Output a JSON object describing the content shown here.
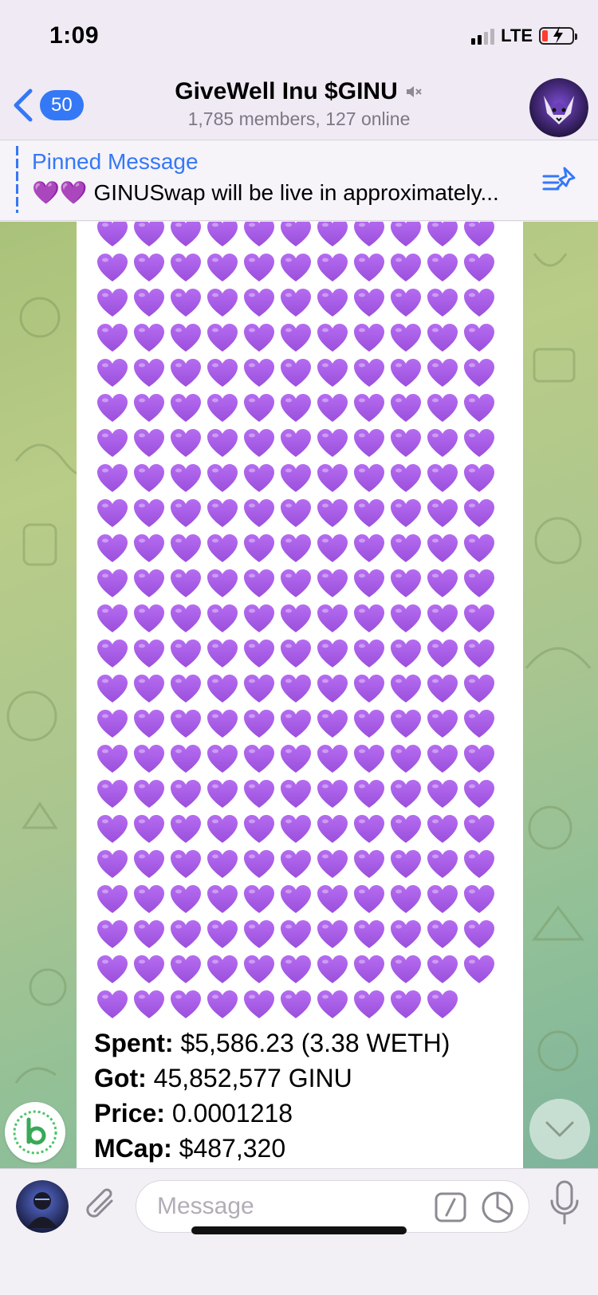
{
  "status_bar": {
    "time": "1:09",
    "network": "LTE",
    "signal_bars_filled": 2,
    "battery_level": 0.15
  },
  "header": {
    "unread_count": "50",
    "title": "GiveWell Inu $GINU",
    "subtitle": "1,785 members, 127 online",
    "muted": true
  },
  "pinned": {
    "title": "Pinned Message",
    "text": "💜💜 GINUSwap will be live in approximately..."
  },
  "message": {
    "heart_emoji": "purple-heart",
    "heart_color": "#9b4fdc",
    "heart_rows_visible": 23,
    "heart_count_visible": 252,
    "stats": [
      {
        "label": "Spent:",
        "value": "$5,586.23 (3.38 WETH)"
      },
      {
        "label": "Got:",
        "value": "45,852,577 GINU"
      },
      {
        "label": "Price:",
        "value": "0.0001218"
      },
      {
        "label": "MCap:",
        "value": "$487,320"
      }
    ]
  },
  "input": {
    "placeholder": "Message"
  },
  "colors": {
    "accent": "#3478f6",
    "bubble": "#ffffff"
  }
}
